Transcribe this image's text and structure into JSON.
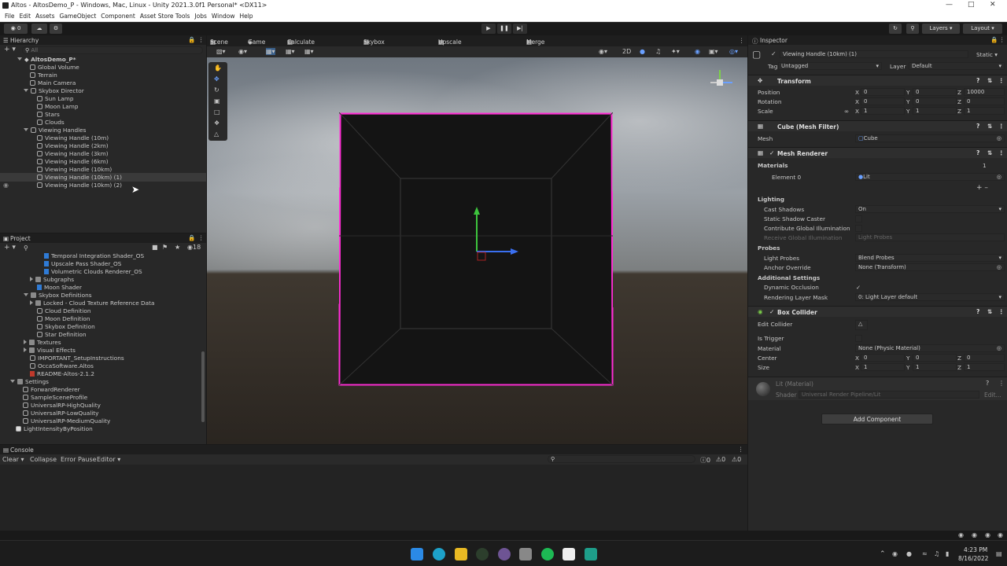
{
  "window": {
    "title": "Altos - AltosDemo_P - Windows, Mac, Linux - Unity 2021.3.0f1 Personal* <DX11>"
  },
  "menu": [
    "File",
    "Edit",
    "Assets",
    "GameObject",
    "Component",
    "Asset Store Tools",
    "Jobs",
    "Window",
    "Help"
  ],
  "toolbar": {
    "layers": "Layers",
    "layout": "Layout",
    "account": "0"
  },
  "hierarchy": {
    "title": "Hierarchy",
    "search": "All",
    "items": [
      "AltosDemo_P*",
      "Global Volume",
      "Terrain",
      "Main Camera",
      "Skybox Director",
      "Sun Lamp",
      "Moon Lamp",
      "Stars",
      "Clouds",
      "Viewing Handles",
      "Viewing Handle (10m)",
      "Viewing Handle (2km)",
      "Viewing Handle (3km)",
      "Viewing Handle (6km)",
      "Viewing Handle (10km)",
      "Viewing Handle (10km) (1)",
      "Viewing Handle (10km) (2)"
    ]
  },
  "project": {
    "title": "Project",
    "badge": "18",
    "items": [
      "Temporal Integration Shader_OS",
      "Upscale Pass Shader_OS",
      "Volumetric Clouds Renderer_OS",
      "Subgraphs",
      "Moon Shader",
      "Skybox Definitions",
      "Locked - Cloud Texture Reference Data",
      "Cloud Definition",
      "Moon Definition",
      "Skybox Definition",
      "Star Definition",
      "Textures",
      "Visual Effects",
      "IMPORTANT_SetupInstructions",
      "OccaSoftware.Altos",
      "README-Altos-2.1.2",
      "Settings",
      "ForwardRenderer",
      "SampleSceneProfile",
      "UniversalRP-HighQuality",
      "UniversalRP-LowQuality",
      "UniversalRP-MediumQuality",
      "LightIntensityByPosition"
    ]
  },
  "scene_tabs": [
    "Scene",
    "Game",
    "Calculate Sky Color",
    "Skybox Shader_OS",
    "Upscale Pass Shader_OS",
    "Merge Pass_OS"
  ],
  "console": {
    "title": "Console",
    "clear": "Clear",
    "collapse": "Collapse",
    "error_pause": "Error Pause",
    "editor": "Editor",
    "c1": "0",
    "c2": "0",
    "c3": "0"
  },
  "inspector": {
    "title": "Inspector",
    "object_name": "Viewing Handle (10km) (1)",
    "static": "Static",
    "tag_label": "Tag",
    "tag": "Untagged",
    "layer_label": "Layer",
    "layer": "Default",
    "transform": {
      "title": "Transform",
      "position": "Position",
      "rotation": "Rotation",
      "scale": "Scale",
      "px": "0",
      "py": "0",
      "pz": "10000",
      "rx": "0",
      "ry": "0",
      "rz": "0",
      "sx": "1",
      "sy": "1",
      "sz": "1"
    },
    "mesh_filter": {
      "title": "Cube (Mesh Filter)",
      "mesh_label": "Mesh",
      "mesh": "Cube"
    },
    "mesh_renderer": {
      "title": "Mesh Renderer",
      "materials": "Materials",
      "count": "1",
      "element": "Element 0",
      "element_val": "Lit",
      "lighting": "Lighting",
      "cast_shadows": "Cast Shadows",
      "cast_val": "On",
      "static_shadow": "Static Shadow Caster",
      "contrib_gi": "Contribute Global Illumination",
      "receive_gi": "Receive Global Illumination",
      "receive_val": "Light Probes",
      "probes": "Probes",
      "light_probes": "Light Probes",
      "light_probes_val": "Blend Probes",
      "anchor": "Anchor Override",
      "anchor_val": "None (Transform)",
      "additional": "Additional Settings",
      "dyn_occ": "Dynamic Occlusion",
      "rlm": "Rendering Layer Mask",
      "rlm_val": "0: Light Layer default"
    },
    "box_collider": {
      "title": "Box Collider",
      "edit": "Edit Collider",
      "trigger": "Is Trigger",
      "material": "Material",
      "material_val": "None (Physic Material)",
      "center": "Center",
      "size": "Size",
      "cx": "0",
      "cy": "0",
      "cz": "0",
      "sx": "1",
      "sy": "1",
      "sz": "1"
    },
    "material": {
      "name": "Lit (Material)",
      "shader_label": "Shader",
      "shader": "Universal Render Pipeline/Lit",
      "edit": "Edit..."
    },
    "add_component": "Add Component"
  },
  "taskbar": {
    "time": "4:23 PM",
    "date": "8/16/2022"
  },
  "colors": {
    "selection": "#ff2dd4",
    "accent": "#2f7bd6"
  }
}
